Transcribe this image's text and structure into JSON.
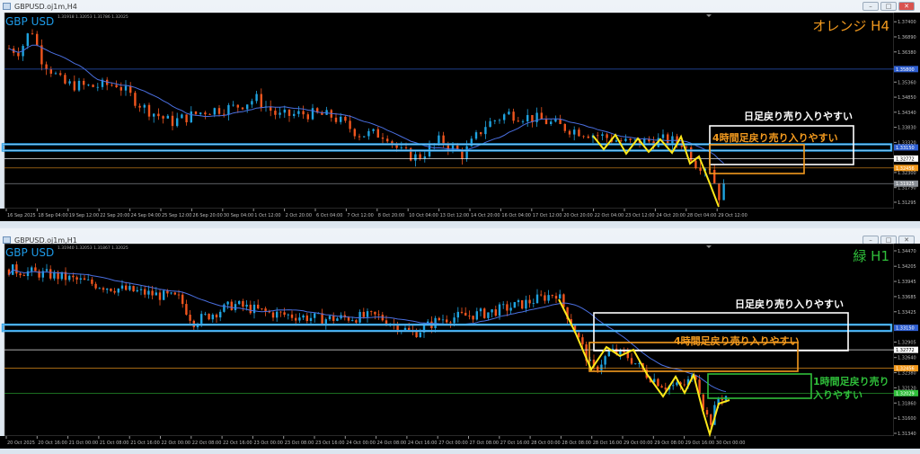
{
  "top": {
    "title": "GBPUSD.oj1m,H4",
    "symbol": "GBP USD",
    "ohlc": "1.31918 1.32053 1.31786 1.32025",
    "label": "オレンジ H4",
    "price_ticks": [
      "1.37400",
      "1.36890",
      "1.36380",
      "1.35360",
      "1.34850",
      "1.34340",
      "1.33830",
      "1.33320",
      "1.32300",
      "1.31790",
      "1.31295"
    ],
    "price_tick_values": [
      1.374,
      1.3689,
      1.3638,
      1.3536,
      1.3485,
      1.3434,
      1.3383,
      1.3332,
      1.323,
      1.3179,
      1.31295
    ],
    "markers": [
      {
        "text": "1.35800",
        "value": 1.358,
        "color": "#2f5fd0"
      },
      {
        "text": "1.33150",
        "value": 1.3315,
        "color": "#2f5fd0"
      },
      {
        "text": "1.32772",
        "value": 1.32772,
        "color": "#ffffff"
      },
      {
        "text": "1.32456",
        "value": 1.32456,
        "color": "#f39a1e"
      },
      {
        "text": "1.31925",
        "value": 1.31925,
        "color": "#8a8f96"
      }
    ],
    "time_ticks": [
      "16 Sep 2025",
      "18 Sep 04:00",
      "19 Sep 12:00",
      "22 Sep 20:00",
      "24 Sep 04:00",
      "25 Sep 12:00",
      "26 Sep 20:00",
      "30 Sep 04:00",
      "1 Oct 12:00",
      "2 Oct 20:00",
      "6 Oct 04:00",
      "7 Oct 12:00",
      "8 Oct 20:00",
      "10 Oct 04:00",
      "13 Oct 12:00",
      "14 Oct 20:00",
      "16 Oct 04:00",
      "17 Oct 12:00",
      "20 Oct 20:00",
      "22 Oct 04:00",
      "23 Oct 12:00",
      "24 Oct 20:00",
      "28 Oct 04:00",
      "29 Oct 12:00"
    ],
    "daily_text": "日足戻り売り入りやすい",
    "h4_text": "4時間足戻り売り入りやすい",
    "path": [
      [
        10,
        1.365
      ],
      [
        22,
        1.364
      ],
      [
        35,
        1.372
      ],
      [
        45,
        1.362
      ],
      [
        70,
        1.353
      ],
      [
        100,
        1.352
      ],
      [
        130,
        1.353
      ],
      [
        160,
        1.345
      ],
      [
        190,
        1.34
      ],
      [
        230,
        1.344
      ],
      [
        260,
        1.345
      ],
      [
        285,
        1.348
      ],
      [
        310,
        1.342
      ],
      [
        340,
        1.343
      ],
      [
        370,
        1.342
      ],
      [
        400,
        1.336
      ],
      [
        430,
        1.336
      ],
      [
        445,
        1.33
      ],
      [
        465,
        1.328
      ],
      [
        490,
        1.334
      ],
      [
        515,
        1.329
      ],
      [
        540,
        1.339
      ],
      [
        565,
        1.343
      ],
      [
        600,
        1.341
      ],
      [
        630,
        1.338
      ],
      [
        660,
        1.336
      ],
      [
        700,
        1.333
      ],
      [
        740,
        1.334
      ],
      [
        760,
        1.333
      ],
      [
        775,
        1.326
      ],
      [
        790,
        1.325
      ],
      [
        800,
        1.315
      ],
      [
        808,
        1.319
      ]
    ]
  },
  "bottom": {
    "title": "GBPUSD.oj1m,H1",
    "symbol": "GBP USD",
    "ohlc": "1.31940 1.32053 1.31867 1.32025",
    "label": "緑 H1",
    "price_ticks": [
      "1.34470",
      "1.34205",
      "1.33945",
      "1.33685",
      "1.33425",
      "1.32905",
      "1.32640",
      "1.32380",
      "1.32120",
      "1.31860",
      "1.31600",
      "1.31340"
    ],
    "price_tick_values": [
      1.3447,
      1.34205,
      1.33945,
      1.33685,
      1.33425,
      1.32905,
      1.3264,
      1.3238,
      1.3212,
      1.3186,
      1.316,
      1.3134
    ],
    "markers": [
      {
        "text": "1.33150",
        "value": 1.3315,
        "color": "#2f5fd0"
      },
      {
        "text": "1.32772",
        "value": 1.32772,
        "color": "#ffffff"
      },
      {
        "text": "1.32456",
        "value": 1.32456,
        "color": "#f39a1e"
      },
      {
        "text": "1.32029",
        "value": 1.32029,
        "color": "#2fbf3a"
      }
    ],
    "time_ticks": [
      "20 Oct 2025",
      "20 Oct 16:00",
      "21 Oct 00:00",
      "21 Oct 08:00",
      "21 Oct 16:00",
      "22 Oct 00:00",
      "22 Oct 08:00",
      "22 Oct 16:00",
      "23 Oct 00:00",
      "23 Oct 08:00",
      "23 Oct 16:00",
      "24 Oct 00:00",
      "24 Oct 08:00",
      "24 Oct 16:00",
      "27 Oct 00:00",
      "27 Oct 08:00",
      "27 Oct 16:00",
      "28 Oct 00:00",
      "28 Oct 08:00",
      "28 Oct 16:00",
      "29 Oct 00:00",
      "29 Oct 08:00",
      "29 Oct 16:00",
      "30 Oct 00:00"
    ],
    "daily_text": "日足戻り売り入りやすい",
    "h4_text": "4時間足戻り売り入りやすい",
    "h1_text_1": "1時間足戻り売り",
    "h1_text_2": "入りやすい",
    "path": [
      [
        10,
        1.3415
      ],
      [
        60,
        1.3405
      ],
      [
        120,
        1.3385
      ],
      [
        200,
        1.3365
      ],
      [
        215,
        1.3325
      ],
      [
        260,
        1.3355
      ],
      [
        300,
        1.334
      ],
      [
        360,
        1.333
      ],
      [
        420,
        1.3335
      ],
      [
        460,
        1.3305
      ],
      [
        490,
        1.333
      ],
      [
        540,
        1.334
      ],
      [
        580,
        1.3355
      ],
      [
        620,
        1.3375
      ],
      [
        640,
        1.331
      ],
      [
        660,
        1.324
      ],
      [
        680,
        1.3275
      ],
      [
        700,
        1.3265
      ],
      [
        720,
        1.3235
      ],
      [
        740,
        1.3215
      ],
      [
        760,
        1.3215
      ],
      [
        775,
        1.3235
      ],
      [
        782,
        1.3185
      ],
      [
        790,
        1.315
      ],
      [
        800,
        1.3195
      ],
      [
        812,
        1.32
      ]
    ]
  },
  "colors": {
    "up": "#1fa3e0",
    "down": "#f0551e",
    "ma": "#4a6fe0",
    "bg": "#000000",
    "cyan": "#1e9be8",
    "orange": "#f39a1e",
    "white": "#ffffff",
    "green": "#2fbf3a",
    "yellow": "#ffe81a"
  }
}
